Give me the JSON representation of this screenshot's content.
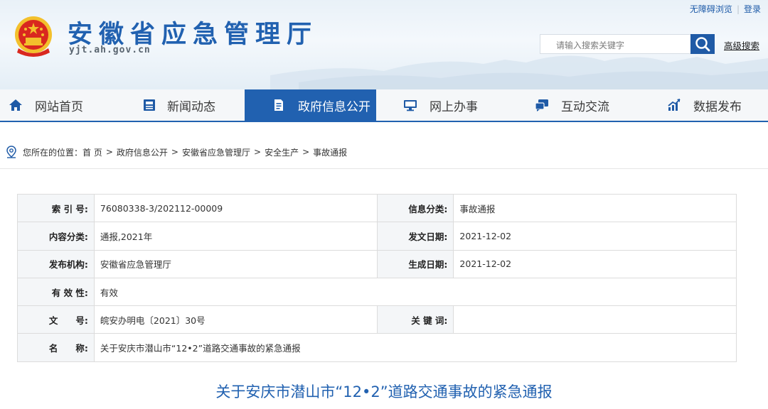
{
  "header": {
    "site_title": "安徽省应急管理厅",
    "domain": "yjt.ah.gov.cn",
    "top_links": {
      "accessible": "无障碍浏览",
      "login": "登录"
    },
    "search": {
      "placeholder": "请输入搜索关键字",
      "advanced_label": "高级搜索"
    },
    "emblem_icon": "national-emblem-icon"
  },
  "nav": {
    "items": [
      {
        "label": "网站首页",
        "icon": "home-icon",
        "active": false
      },
      {
        "label": "新闻动态",
        "icon": "news-icon",
        "active": false
      },
      {
        "label": "政府信息公开",
        "icon": "document-icon",
        "active": true
      },
      {
        "label": "网上办事",
        "icon": "monitor-icon",
        "active": false
      },
      {
        "label": "互动交流",
        "icon": "chat-icon",
        "active": false
      },
      {
        "label": "数据发布",
        "icon": "chart-icon",
        "active": false
      }
    ]
  },
  "breadcrumb": {
    "prefix": "您所在的位置：",
    "path": [
      "首 页",
      "政府信息公开",
      "安徽省应急管理厅",
      "安全生产",
      "事故通报"
    ],
    "separator": ">"
  },
  "info": {
    "index_label": "索 引 号:",
    "index_value": "76080338-3/202112-00009",
    "category_label": "信息分类:",
    "category_value": "事故通报",
    "content_label": "内容分类:",
    "content_value": "通报,2021年",
    "issue_date_label": "发文日期:",
    "issue_date_value": "2021-12-02",
    "org_label": "发布机构:",
    "org_value": "安徽省应急管理厅",
    "gen_date_label": "生成日期:",
    "gen_date_value": "2021-12-02",
    "validity_label": "有 效 性:",
    "validity_value": "有效",
    "doc_no_label": "文　　号:",
    "doc_no_value": "皖安办明电〔2021〕30号",
    "keywords_label": "关 键 词:",
    "keywords_value": "",
    "name_label": "名　　称:",
    "name_value": "关于安庆市潜山市“12•2”道路交通事故的紧急通报"
  },
  "article": {
    "title": "关于安庆市潜山市“12•2”道路交通事故的紧急通报"
  },
  "colors": {
    "brand_blue": "#2161b0",
    "emblem_red": "#d9281f",
    "emblem_gold": "#f3c02c"
  }
}
